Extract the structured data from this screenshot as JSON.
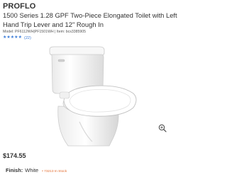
{
  "product": {
    "brand": "PROFLO",
    "title": "1500 Series 1.28 GPF Two-Piece Elongated Toilet with Left Hand Trip Lever and 12\" Rough In",
    "model_info": "Model: PF6112WH|PF1501WH | Item: bcs3385905",
    "rating": {
      "stars": 5,
      "star_glyph": "★",
      "review_count": "(22)"
    },
    "price": "$174.55",
    "finish": {
      "label": "Finish:",
      "value": "White",
      "stock": "• 73213 In Stock"
    }
  },
  "colors": {
    "text": "#333333",
    "rating_blue": "#3e7ed8",
    "stock_orange": "#e26a2c"
  },
  "icons": {
    "zoom": "zoom-in-icon",
    "product_image": "toilet-image"
  }
}
